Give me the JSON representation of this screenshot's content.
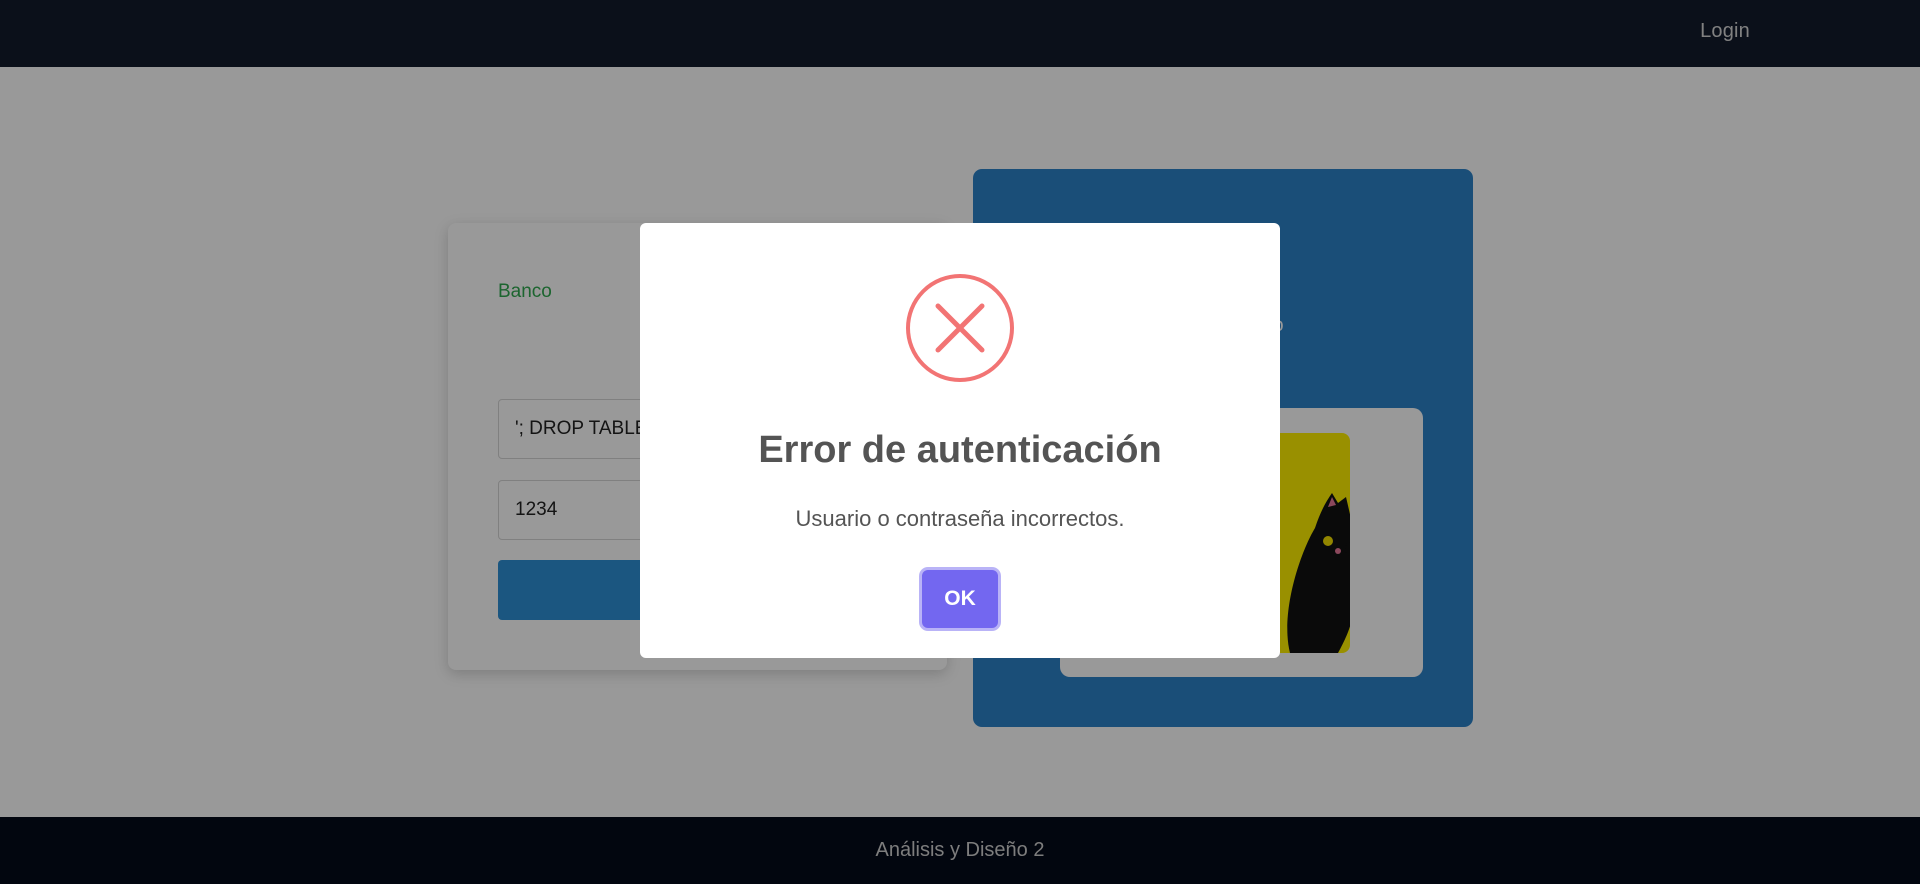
{
  "navbar": {
    "login_label": "Login"
  },
  "login_form": {
    "brand": "Banco",
    "username_value": "'; DROP TABLE",
    "password_value": "1234"
  },
  "side_panel": {
    "partial_text": "o"
  },
  "footer": {
    "text": "Análisis y Diseño 2"
  },
  "modal": {
    "title": "Error de autenticación",
    "message": "Usuario o contraseña incorrectos.",
    "ok_label": "OK"
  },
  "colors": {
    "navbar": "#131b2c",
    "footer": "#040a1a",
    "brand_green": "#2fa84f",
    "panel_blue": "#2c82c9",
    "error_red": "#f27474",
    "ok_purple": "#7367f0"
  },
  "icons": {
    "modal_icon": "error-x-circle-icon",
    "illustration": "black-cat-illustration"
  }
}
